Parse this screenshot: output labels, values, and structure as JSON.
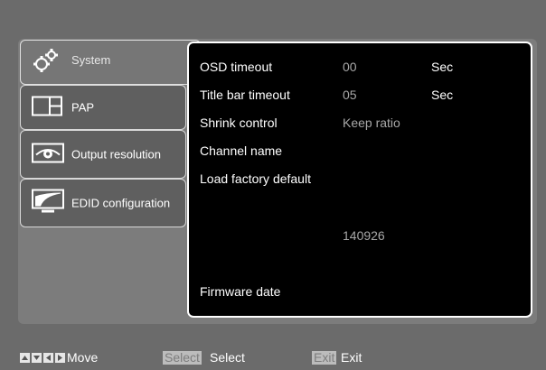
{
  "tabs": [
    {
      "label": "System",
      "icon": "gears-icon",
      "active": true
    },
    {
      "label": "PAP",
      "icon": "pap-layout-icon",
      "active": false
    },
    {
      "label": "Output resolution",
      "icon": "eye-icon",
      "active": false
    },
    {
      "label": "EDID configuration",
      "icon": "monitor-icon",
      "active": false
    }
  ],
  "settings": {
    "osd_timeout": {
      "label": "OSD timeout",
      "value": "00",
      "unit": "Sec"
    },
    "title_bar_timeout": {
      "label": "Title bar timeout",
      "value": "05",
      "unit": "Sec"
    },
    "shrink_control": {
      "label": "Shrink control",
      "value": "Keep ratio"
    },
    "channel_name": {
      "label": "Channel name"
    },
    "load_factory_default": {
      "label": "Load factory default"
    },
    "firmware_value": "140926",
    "firmware_date": {
      "label": "Firmware date"
    }
  },
  "footer": {
    "move_label": "Move",
    "select_key": "Select",
    "select_label": "Select",
    "exit_key": "Exit",
    "exit_label": "Exit"
  }
}
